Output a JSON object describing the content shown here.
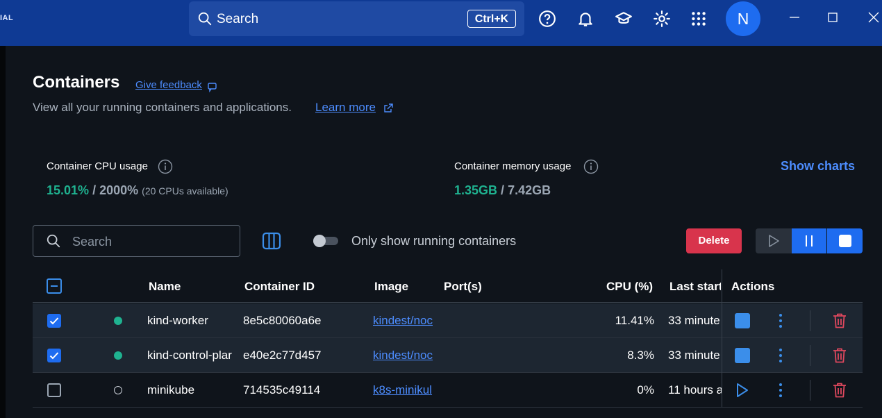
{
  "topbar": {
    "brand": "IAL",
    "search_label": "Search",
    "search_shortcut": "Ctrl+K",
    "avatar_initial": "N"
  },
  "page": {
    "title": "Containers",
    "feedback_link": "Give feedback",
    "subtitle": "View all your running containers and applications.",
    "learn_more": "Learn more"
  },
  "stats": {
    "cpu_label": "Container CPU usage",
    "cpu_used": "15.01%",
    "cpu_sep": " / ",
    "cpu_total": "2000%",
    "cpu_note": "(20 CPUs available)",
    "mem_label": "Container memory usage",
    "mem_used": "1.35GB",
    "mem_sep": " / ",
    "mem_total": "7.42GB",
    "show_charts": "Show charts"
  },
  "toolbar": {
    "search_placeholder": "Search",
    "toggle_label": "Only show running containers",
    "toggle_on": false,
    "delete_label": "Delete"
  },
  "table": {
    "headers": {
      "name": "Name",
      "container_id": "Container ID",
      "image": "Image",
      "ports": "Port(s)",
      "cpu": "CPU (%)",
      "last_started": "Last start",
      "actions": "Actions"
    },
    "rows": [
      {
        "checked": true,
        "status": "running",
        "name": "kind-worker",
        "container_id": "8e5c80060a6e",
        "image": "kindest/noc",
        "ports": "",
        "cpu": "11.41%",
        "last_started": "33 minute"
      },
      {
        "checked": true,
        "status": "running",
        "name": "kind-control-plar",
        "container_id": "e40e2c77d457",
        "image": "kindest/noc",
        "ports": "",
        "cpu": "8.3%",
        "last_started": "33 minute"
      },
      {
        "checked": false,
        "status": "stopped",
        "name": "minikube",
        "container_id": "714535c49114",
        "image": "k8s-minikul",
        "ports": "",
        "cpu": "0%",
        "last_started": "11 hours a"
      }
    ]
  },
  "colors": {
    "topbar": "#0f3a94",
    "accent": "#1e6cf0",
    "link": "#4d8dff",
    "running": "#1fb290",
    "danger": "#d8344c"
  }
}
